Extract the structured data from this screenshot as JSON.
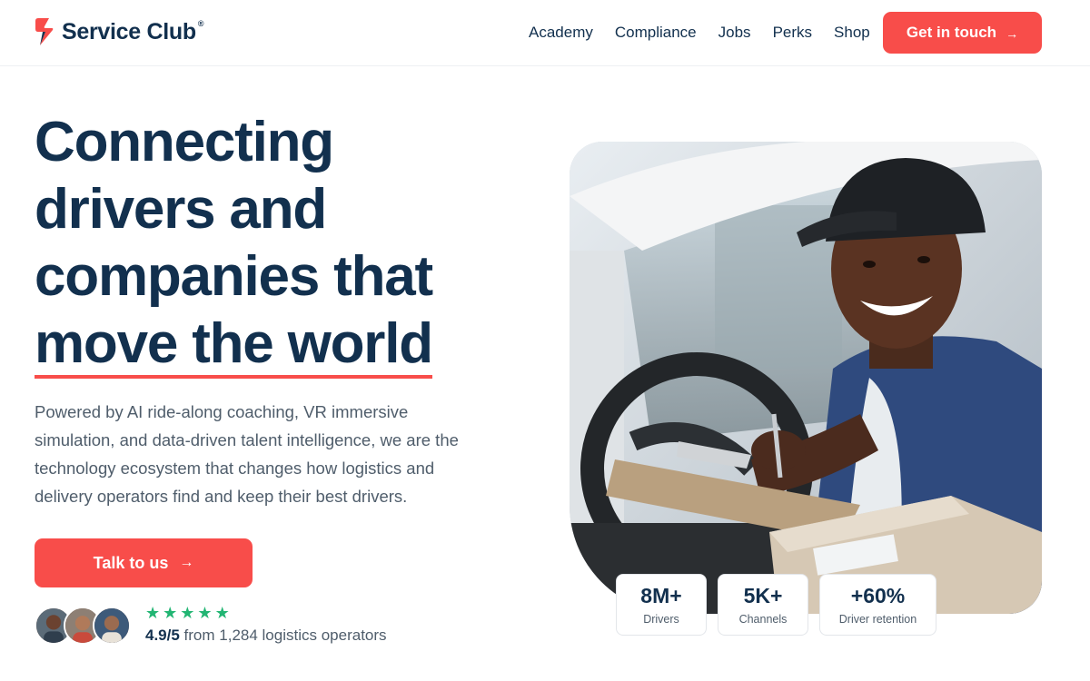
{
  "brand": {
    "name": "Service Club",
    "registered": "®",
    "accent": "#f84d4a",
    "navy": "#12304e"
  },
  "nav": {
    "items": [
      "Academy",
      "Compliance",
      "Jobs",
      "Perks",
      "Shop"
    ],
    "cta_label": "Get in touch",
    "cta_arrow": "→"
  },
  "hero": {
    "headline_lines": [
      "Connecting",
      "drivers and",
      "companies that",
      "move the world"
    ],
    "lead": "Powered by AI ride-along coaching, VR immersive simulation, and data-driven talent intelligence, we are the technology ecosystem that changes how logistics and delivery operators find and keep their best drivers.",
    "cta_label": "Talk to us",
    "cta_arrow": "→"
  },
  "social_proof": {
    "stars": [
      "★",
      "★",
      "★",
      "★",
      "★"
    ],
    "score": "4.9/5",
    "text": "from 1,284 logistics operators"
  },
  "stats": [
    {
      "value": "8M+",
      "label": "Drivers"
    },
    {
      "value": "5K+",
      "label": "Channels"
    },
    {
      "value": "+60%",
      "label": "Driver retention"
    }
  ]
}
